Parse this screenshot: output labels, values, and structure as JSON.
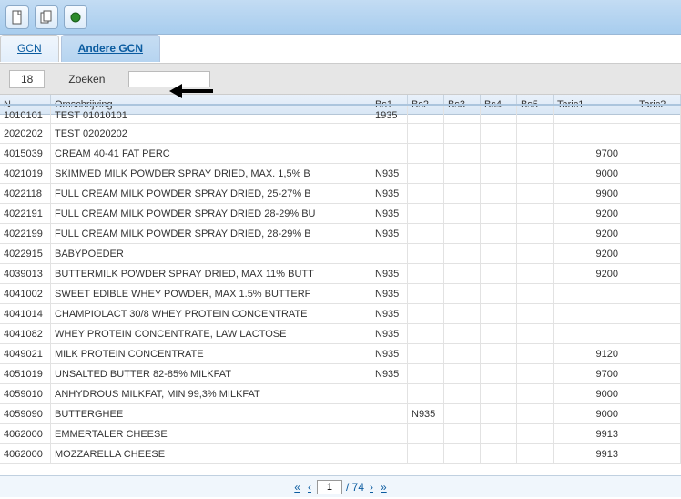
{
  "toolbar": {
    "btn_new": "new-document",
    "btn_copy": "copy-document",
    "btn_go": "run"
  },
  "tabs": {
    "gcn": "GCN",
    "andere_gcn": "Andere GCN"
  },
  "searchbar": {
    "count": "18",
    "zoeken_label": "Zoeken",
    "zoeken_value": ""
  },
  "columns": {
    "n": "N",
    "oms": "Omschrijving",
    "bs1": "Bs1",
    "bs2": "Bs2",
    "bs3": "Bs3",
    "bs4": "Bs4",
    "bs5": "Bs5",
    "taric1": "Taric1",
    "taric2": "Taric2"
  },
  "rows": [
    {
      "n": "1010101",
      "oms": "TEST 01010101",
      "bs1": "1935",
      "bs2": "",
      "taric1": ""
    },
    {
      "n": "2020202",
      "oms": "TEST 02020202",
      "bs1": "",
      "bs2": "",
      "taric1": ""
    },
    {
      "n": "4015039",
      "oms": "CREAM 40-41 FAT PERC",
      "bs1": "",
      "bs2": "",
      "taric1": "9700"
    },
    {
      "n": "4021019",
      "oms": "SKIMMED MILK POWDER SPRAY DRIED, MAX. 1,5% B",
      "bs1": "N935",
      "bs2": "",
      "taric1": "9000"
    },
    {
      "n": "4022118",
      "oms": "FULL CREAM MILK POWDER SPRAY DRIED, 25-27% B",
      "bs1": "N935",
      "bs2": "",
      "taric1": "9900"
    },
    {
      "n": "4022191",
      "oms": "FULL CREAM MILK POWDER SPRAY DRIED 28-29% BU",
      "bs1": "N935",
      "bs2": "",
      "taric1": "9200"
    },
    {
      "n": "4022199",
      "oms": "FULL CREAM MILK POWDER SPRAY DRIED, 28-29% B",
      "bs1": "N935",
      "bs2": "",
      "taric1": "9200"
    },
    {
      "n": "4022915",
      "oms": "BABYPOEDER",
      "bs1": "",
      "bs2": "",
      "taric1": "9200"
    },
    {
      "n": "4039013",
      "oms": "BUTTERMILK POWDER SPRAY DRIED, MAX 11% BUTT",
      "bs1": "N935",
      "bs2": "",
      "taric1": "9200"
    },
    {
      "n": "4041002",
      "oms": "SWEET EDIBLE WHEY POWDER, MAX 1.5% BUTTERF",
      "bs1": "N935",
      "bs2": "",
      "taric1": ""
    },
    {
      "n": "4041014",
      "oms": "CHAMPIOLACT 30/8 WHEY PROTEIN CONCENTRATE",
      "bs1": "N935",
      "bs2": "",
      "taric1": ""
    },
    {
      "n": "4041082",
      "oms": "WHEY PROTEIN CONCENTRATE, LAW LACTOSE",
      "bs1": "N935",
      "bs2": "",
      "taric1": ""
    },
    {
      "n": "4049021",
      "oms": "MILK PROTEIN CONCENTRATE",
      "bs1": "N935",
      "bs2": "",
      "taric1": "9120"
    },
    {
      "n": "4051019",
      "oms": "UNSALTED BUTTER 82-85% MILKFAT",
      "bs1": "N935",
      "bs2": "",
      "taric1": "9700"
    },
    {
      "n": "4059010",
      "oms": "ANHYDROUS MILKFAT, MIN 99,3% MILKFAT",
      "bs1": "",
      "bs2": "",
      "taric1": "9000"
    },
    {
      "n": "4059090",
      "oms": "BUTTERGHEE",
      "bs1": "",
      "bs2": "N935",
      "taric1": "9000"
    },
    {
      "n": "4062000",
      "oms": "EMMERTALER CHEESE",
      "bs1": "",
      "bs2": "",
      "taric1": "9913"
    },
    {
      "n": "4062000",
      "oms": "MOZZARELLA CHEESE",
      "bs1": "",
      "bs2": "",
      "taric1": "9913"
    }
  ],
  "paginator": {
    "first": "«",
    "prev": "‹",
    "page": "1",
    "of": "/ 74",
    "next": "›",
    "last": "»"
  }
}
